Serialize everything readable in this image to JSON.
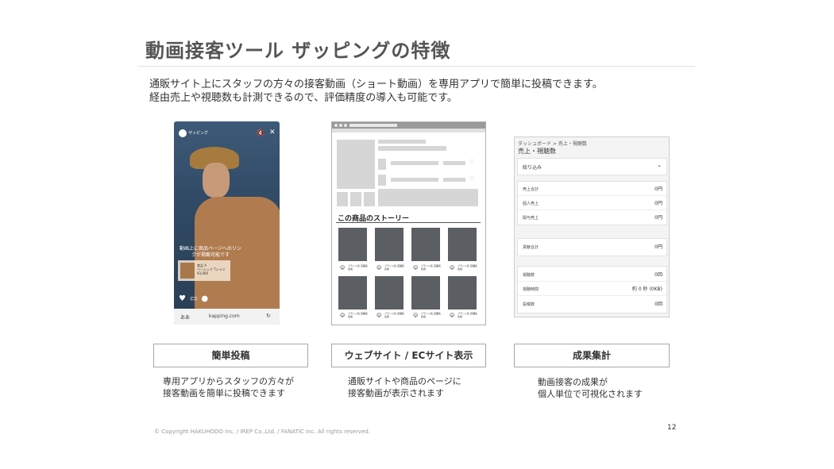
{
  "title": "動画接客ツール ザッピングの特徴",
  "intro": [
    "通販サイト上にスタッフの方々の接客動画（ショート動画）を専用アプリで簡単に投稿できます。",
    "経由売上や視聴数も計測できるので、評価精度の導入も可能です。"
  ],
  "phone": {
    "app_name": "ザッピング",
    "caption": "動画上に商品ページへのリンクが掲載可能です",
    "product_text": [
      "商品 A",
      "ベーシック Tシャツ",
      "¥3,000"
    ],
    "url_aa": "ああ",
    "url": "kapping.com"
  },
  "browser": {
    "story_heading": "この商品のストーリー",
    "story_user_text": "ブランド名 店舗名 名前"
  },
  "dashboard": {
    "breadcrumb": "ダッシュボード  >  売上・視聴数",
    "title": "売上・視聴数",
    "filter_label": "絞り込み",
    "group1": [
      {
        "label": "売上合計",
        "value": "0円"
      },
      {
        "label": "個人売上",
        "value": "0円"
      },
      {
        "label": "関与売上",
        "value": "0円"
      }
    ],
    "group2": [
      {
        "label": "貢献合計",
        "value": "0円"
      }
    ],
    "group3": [
      {
        "label": "視聴数",
        "value": "0回"
      },
      {
        "label": "視聴時間",
        "value": "約 0 秒 (0KB)"
      },
      {
        "label": "投稿数",
        "value": "0回"
      }
    ]
  },
  "features": [
    {
      "label": "簡単投稿",
      "desc": [
        "専用アプリからスタッフの方々が",
        "接客動画を簡単に投稿できます"
      ]
    },
    {
      "label": "ウェブサイト / ECサイト表示",
      "desc": [
        "通販サイトや商品のページに",
        "接客動画が表示されます"
      ]
    },
    {
      "label": "成果集計",
      "desc": [
        "動画接客の成果が",
        "個人単位で可視化されます"
      ]
    }
  ],
  "copyright": "© Copyright HAKUHODO Inc. / IREP Co.,Ltd. / FANATIC Inc. All rights reserved.",
  "page_number": "12"
}
